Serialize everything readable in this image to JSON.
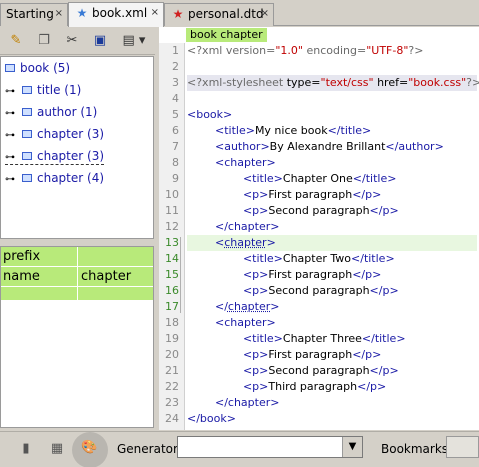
{
  "tabs": [
    {
      "label": "Starting",
      "close": "×"
    },
    {
      "label": "book.xml",
      "close": "×",
      "icon": "star-blue-icon"
    },
    {
      "label": "personal.dtd",
      "close": "×",
      "icon": "star-red-icon"
    }
  ],
  "tree": {
    "root": "book (5)",
    "children": [
      "title (1)",
      "author (1)",
      "chapter (3)",
      "chapter (3)",
      "chapter (4)"
    ]
  },
  "properties": {
    "header": "prefix",
    "name_label": "name",
    "name_value": "chapter"
  },
  "editor": {
    "breadcrumb": "book chapter",
    "line_numbers": [
      "1",
      "2",
      "3",
      "4",
      "5",
      "6",
      "7",
      "8",
      "9",
      "10",
      "11",
      "12",
      "13",
      "14",
      "15",
      "16",
      "17",
      "18",
      "19",
      "20",
      "21",
      "22",
      "23",
      "24"
    ],
    "texts": {
      "l7": "My nice book",
      "l8": "By Alexandre Brillant",
      "l10": "Chapter One",
      "l11": "First paragraph",
      "l12": "Second paragraph",
      "l14": "Chapter Two",
      "l15": "First paragraph",
      "l16": "Second paragraph",
      "l19": "Chapter Three",
      "l20": "First paragraph",
      "l21": "Second paragraph",
      "l22": "Third paragraph"
    }
  },
  "statusbar": {
    "generator_label": "Generator",
    "generator_value": "",
    "bookmarks_label": "Bookmarks"
  },
  "colors": {
    "tag": "#1a1aa6",
    "string": "#c00000",
    "highlight_green": "#b8ea7a"
  }
}
